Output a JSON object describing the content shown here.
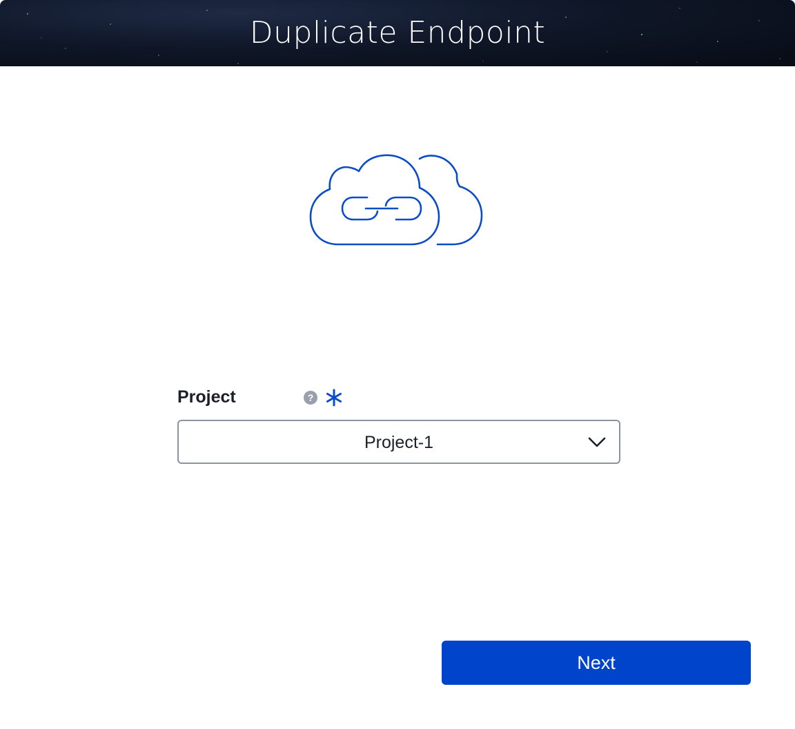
{
  "dialog": {
    "title": "Duplicate Endpoint",
    "hero_icon": "cloud-link-icon"
  },
  "form": {
    "project": {
      "label": "Project",
      "help_icon": "question-circle-icon",
      "help_glyph": "?",
      "required_icon": "asterisk-icon",
      "selected_value": "Project-1",
      "dropdown_icon": "chevron-down-icon"
    }
  },
  "actions": {
    "next_label": "Next"
  },
  "colors": {
    "accent": "#0044cc",
    "header_bg": "#0b1220",
    "help_icon": "#9aa0ab",
    "border": "#8b92a0",
    "text": "#1c1f2a"
  }
}
